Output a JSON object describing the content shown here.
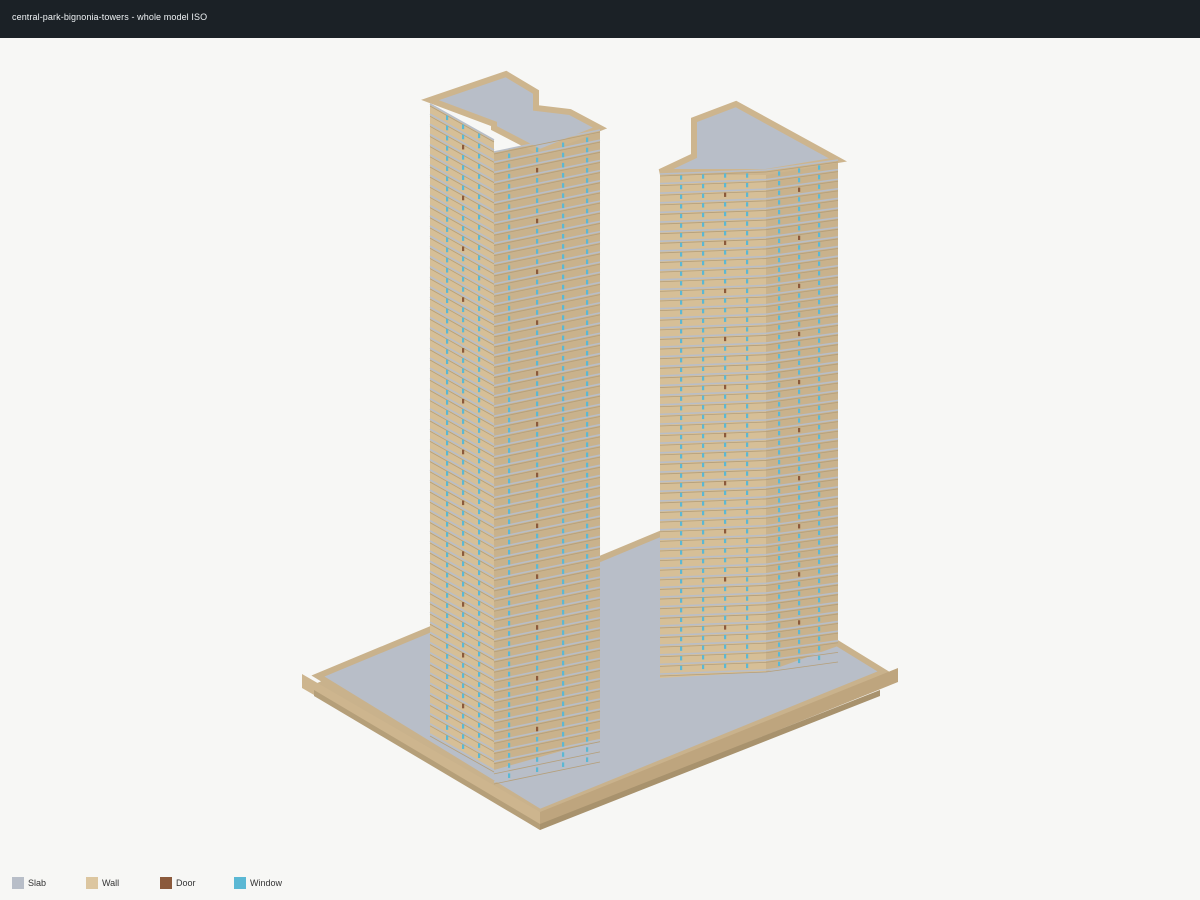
{
  "header": {
    "title": "central-park-bignonia-towers - whole model ISO"
  },
  "legend": [
    {
      "key": "slab",
      "label": "Slab",
      "color": "#b8bec8"
    },
    {
      "key": "wall",
      "label": "Wall",
      "color": "#dcc6a0"
    },
    {
      "key": "door",
      "label": "Door",
      "color": "#8b5a3c"
    },
    {
      "key": "window",
      "label": "Window",
      "color": "#5bb8d4"
    }
  ],
  "colors": {
    "background": "#f7f7f5",
    "header_bg": "#1b2126",
    "slab": "#b8bec8",
    "wall": "#dcc6a0",
    "wall_dark": "#c9b28c",
    "wall_shadow": "#b59f79",
    "door": "#8b5a3c",
    "window": "#5bb8d4"
  },
  "model": {
    "view": "ISO",
    "elements": [
      "podium",
      "tower-west",
      "tower-east"
    ],
    "tower_west_floors": 62,
    "tower_east_floors": 52
  }
}
